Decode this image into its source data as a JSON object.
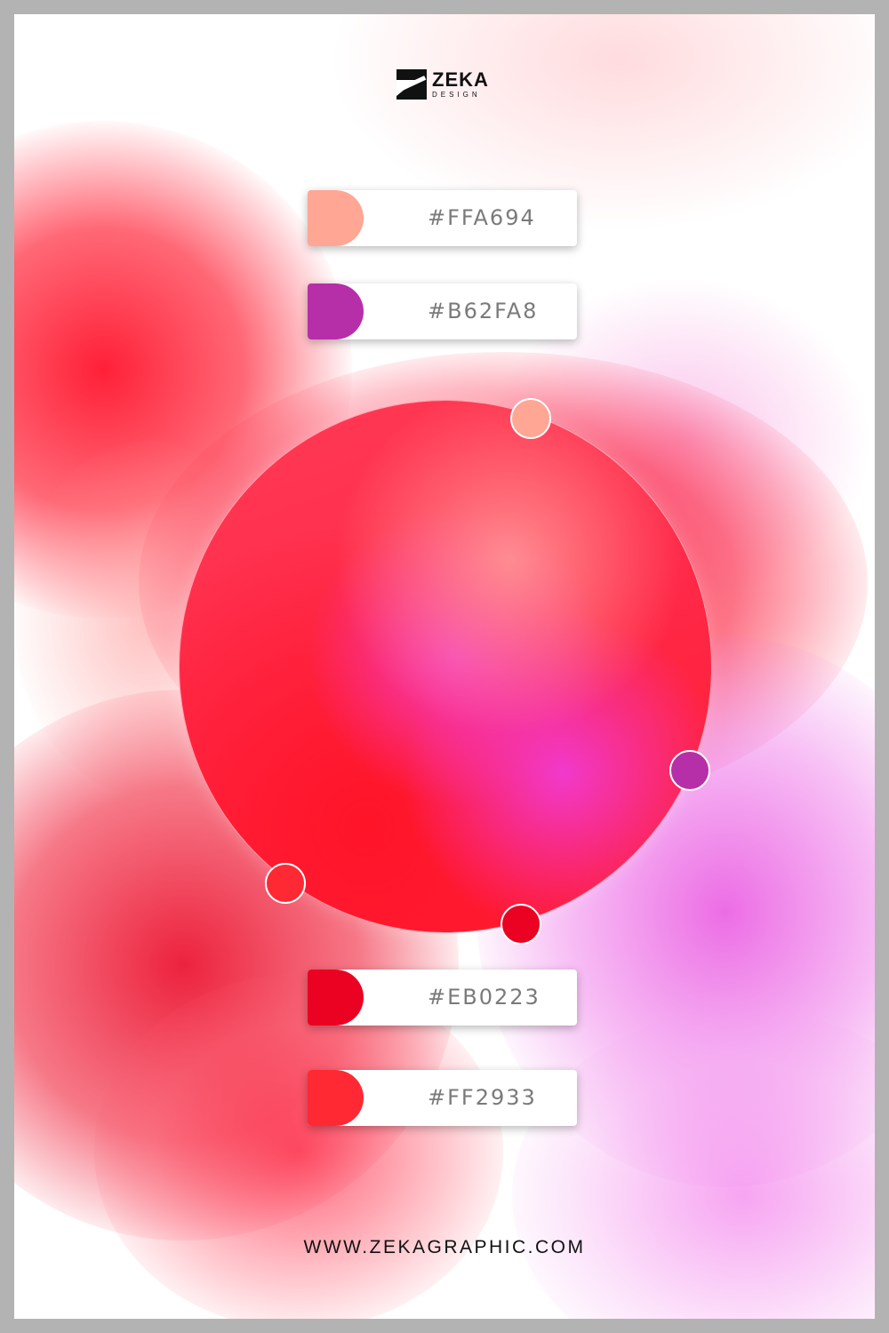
{
  "brand": {
    "name": "ZEKA",
    "tagline": "DESIGN"
  },
  "palette": [
    {
      "hex": "#FFA694",
      "label": "#FFA694"
    },
    {
      "hex": "#B62FA8",
      "label": "#B62FA8"
    },
    {
      "hex": "#EB0223",
      "label": "#EB0223"
    },
    {
      "hex": "#FF2933",
      "label": "#FF2933"
    }
  ],
  "wheel_dots": [
    {
      "color": "#FFA694"
    },
    {
      "color": "#B62FA8"
    },
    {
      "color": "#EB0223"
    },
    {
      "color": "#FF2933"
    }
  ],
  "footer": {
    "url": "WWW.ZEKAGRAPHIC.COM"
  }
}
